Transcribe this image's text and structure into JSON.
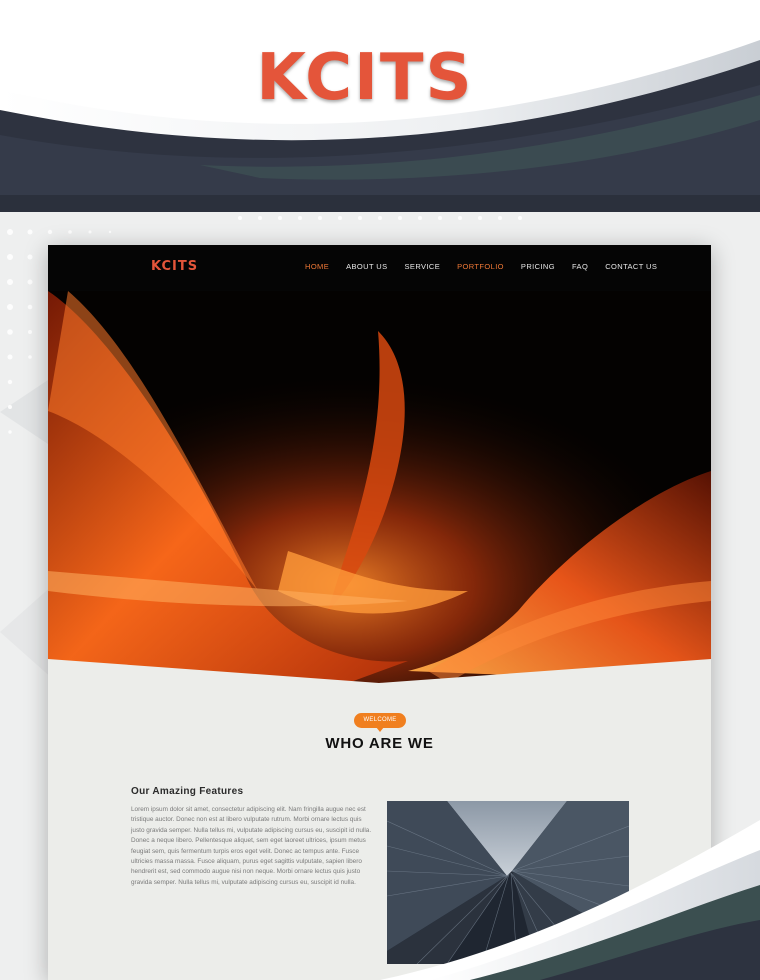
{
  "brand": {
    "logo_text": "KCITS"
  },
  "nav": {
    "logo_text": "KCITS",
    "items": [
      "HOME",
      "ABOUT US",
      "SERVICE",
      "PORTFOLIO",
      "PRICING",
      "FAQ",
      "CONTACT US"
    ]
  },
  "welcome": {
    "badge": "WELCOME",
    "title": "WHO ARE WE"
  },
  "features": {
    "title": "Our Amazing Features",
    "body": "Lorem ipsum dolor sit amet, consectetur adipiscing elit. Nam fringilla augue nec est tristique auctor. Donec non est at libero vulputate rutrum. Morbi ornare lectus quis justo gravida semper. Nulla tellus mi, vulputate adipiscing cursus eu, suscipit id nulla. Donec a neque libero. Pellentesque aliquet, sem eget laoreet ultrices, ipsum metus feugiat sem, quis fermentum turpis eros eget velit. Donec ac tempus ante. Fusce ultricies massa massa. Fusce aliquam, purus eget sagittis vulputate, sapien libero hendrerit est, sed commodo augue nisi non neque. Morbi ornare lectus quis justo gravida semper. Nulla tellus mi, vulputate adipiscing cursus eu, suscipit id nulla."
  },
  "colors": {
    "accent": "#e4553a",
    "orange": "#f07f1f",
    "dark": "#2d3340",
    "nav_bg": "#050505"
  }
}
